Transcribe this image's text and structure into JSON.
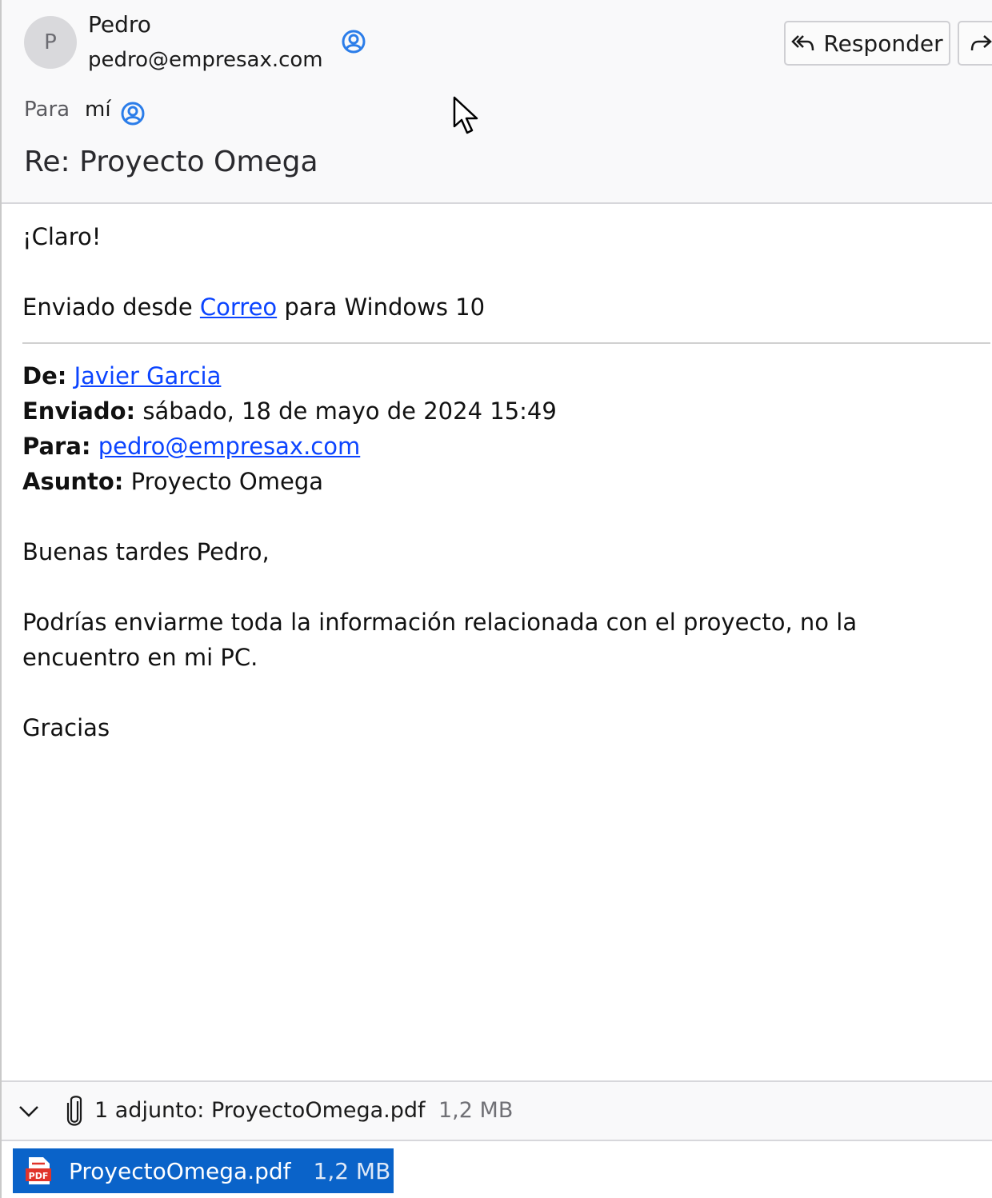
{
  "header": {
    "avatar_letter": "P",
    "sender_name": "Pedro",
    "sender_email": "pedro@empresax.com",
    "reply_label": "Responder",
    "to_label": "Para",
    "to_value": "mí",
    "subject": "Re: Proyecto Omega"
  },
  "body": {
    "line1": "¡Claro!",
    "sent_from_prefix": "Enviado desde ",
    "sent_from_link": "Correo",
    "sent_from_suffix": " para Windows 10",
    "quoted": {
      "from_label": "De:",
      "from_value": "Javier Garcia",
      "sent_label": "Enviado:",
      "sent_value": " sábado, 18 de mayo de 2024 15:49",
      "to_label": "Para:",
      "to_value": "pedro@empresax.com",
      "subject_label": "Asunto:",
      "subject_value": " Proyecto Omega"
    },
    "greeting": "Buenas tardes Pedro,",
    "paragraph_line1": "Podrías enviarme toda la información relacionada con el proyecto, no la",
    "paragraph_line2": "encuentro en mi PC.",
    "closing": "Gracias"
  },
  "attachments": {
    "summary": "1 adjunto: ProyectoOmega.pdf",
    "size": "1,2 MB",
    "file_name": "ProyectoOmega.pdf",
    "file_size": "1,2 MB"
  },
  "colors": {
    "link": "#0b44ff",
    "contact_icon": "#2b7de9",
    "attachment_chip": "#0a63c9",
    "pdf_icon": "#e0342b"
  }
}
